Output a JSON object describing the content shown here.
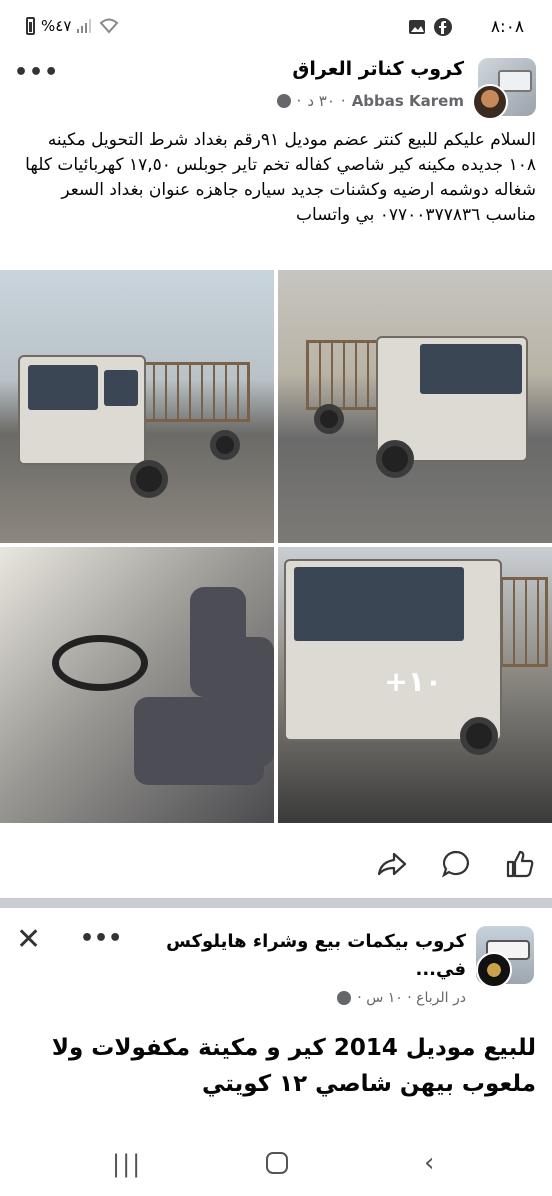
{
  "status_bar": {
    "time": "٨:٠٨",
    "battery": "%٤٧",
    "icons": [
      "battery-icon",
      "signal-icon",
      "wifi-icon",
      "gallery-icon",
      "facebook-icon"
    ]
  },
  "post1": {
    "group_name": "كروب كناتر العراق",
    "author": "Abbas Karem",
    "time": "٣٠ د",
    "text": "السلام عليكم للبيع كنتر عضم موديل ٩١رقم بغداد شرط التحويل مكينه ١٠٨ جديده مكينه كير شاصي كفاله تخم تاير جوبلس ١٧,٥٠ كهربائيات كلها شغاله دوشمه ارضيه وكشنات جديد سياره جاهزه عنوان بغداد السعر مناسب ٠٧٧٠٠٣٧٧٨٣٦ بي واتساب",
    "more_photos_label": "+١٠",
    "actions": {
      "like": "like-icon",
      "comment": "comment-icon",
      "share": "share-icon"
    }
  },
  "post2": {
    "group_name": "كروب بيكمات بيع وشراء هايلوكس في...",
    "meta": "در الرباع · ١٠ س ·",
    "text": "للبيع موديل 2014 كير و مكينة مكفولات ولا ملعوب بيهن شاصي ١٢ كويتي"
  },
  "nav": {
    "recents": "|||",
    "back": "‹"
  }
}
